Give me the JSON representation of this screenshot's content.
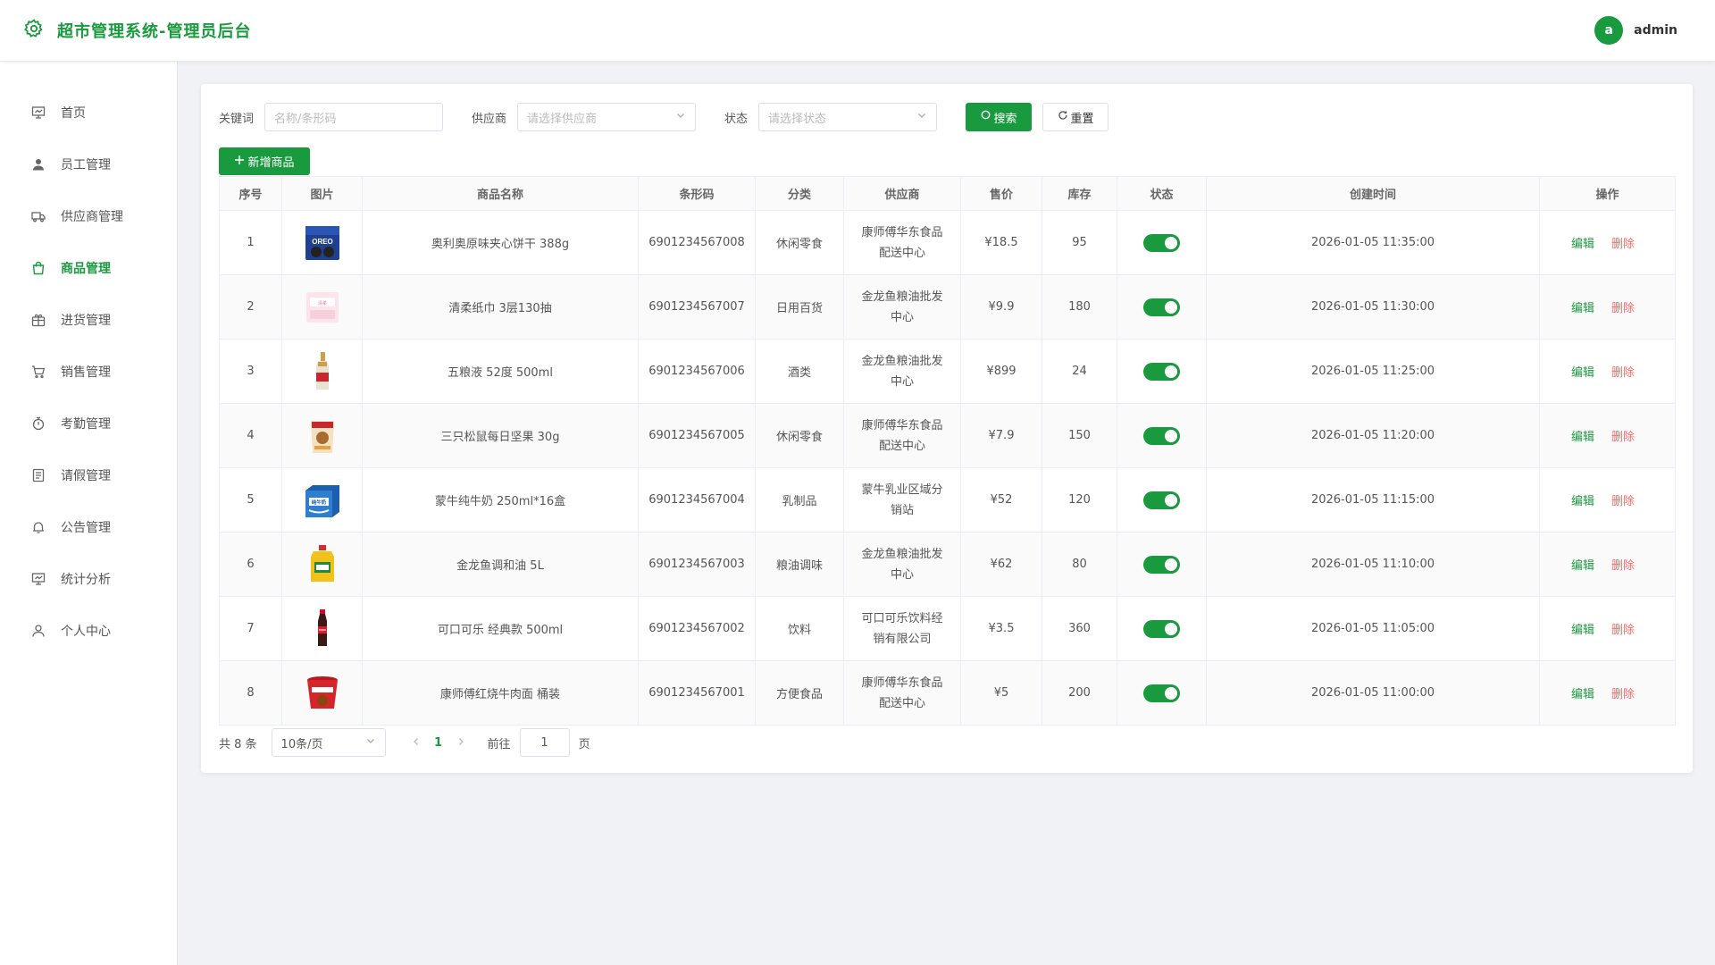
{
  "header": {
    "title": "超市管理系统-管理员后台",
    "avatar_letter": "a",
    "username": "admin"
  },
  "sidebar": {
    "items": [
      {
        "label": "首页",
        "icon": "dashboard-icon",
        "active": false
      },
      {
        "label": "员工管理",
        "icon": "user-icon",
        "active": false
      },
      {
        "label": "供应商管理",
        "icon": "truck-icon",
        "active": false
      },
      {
        "label": "商品管理",
        "icon": "shopping-bag-icon",
        "active": true
      },
      {
        "label": "进货管理",
        "icon": "package-icon",
        "active": false
      },
      {
        "label": "销售管理",
        "icon": "cart-icon",
        "active": false
      },
      {
        "label": "考勤管理",
        "icon": "stopwatch-icon",
        "active": false
      },
      {
        "label": "请假管理",
        "icon": "document-icon",
        "active": false
      },
      {
        "label": "公告管理",
        "icon": "bell-icon",
        "active": false
      },
      {
        "label": "统计分析",
        "icon": "chart-icon",
        "active": false
      },
      {
        "label": "个人中心",
        "icon": "person-icon",
        "active": false
      }
    ]
  },
  "filters": {
    "keyword_label": "关键词",
    "keyword_placeholder": "名称/条形码",
    "supplier_label": "供应商",
    "supplier_placeholder": "请选择供应商",
    "status_label": "状态",
    "status_placeholder": "请选择状态",
    "search_label": "搜索",
    "reset_label": "重置"
  },
  "add_button_label": "新增商品",
  "table": {
    "headers": [
      "序号",
      "图片",
      "商品名称",
      "条形码",
      "分类",
      "供应商",
      "售价",
      "库存",
      "状态",
      "创建时间",
      "操作"
    ],
    "edit_label": "编辑",
    "delete_label": "删除",
    "rows": [
      {
        "idx": "1",
        "name": "奥利奥原味夹心饼干 388g",
        "barcode": "6901234567008",
        "category": "休闲零食",
        "supplier": "康师傅华东食品配送中心",
        "price": "¥18.5",
        "stock": "95",
        "enabled": true,
        "created": "2026-01-05 11:35:00",
        "thumb": "oreo"
      },
      {
        "idx": "2",
        "name": "清柔纸巾 3层130抽",
        "barcode": "6901234567007",
        "category": "日用百货",
        "supplier": "金龙鱼粮油批发中心",
        "price": "¥9.9",
        "stock": "180",
        "enabled": true,
        "created": "2026-01-05 11:30:00",
        "thumb": "tissue"
      },
      {
        "idx": "3",
        "name": "五粮液 52度 500ml",
        "barcode": "6901234567006",
        "category": "酒类",
        "supplier": "金龙鱼粮油批发中心",
        "price": "¥899",
        "stock": "24",
        "enabled": true,
        "created": "2026-01-05 11:25:00",
        "thumb": "liquor"
      },
      {
        "idx": "4",
        "name": "三只松鼠每日坚果 30g",
        "barcode": "6901234567005",
        "category": "休闲零食",
        "supplier": "康师傅华东食品配送中心",
        "price": "¥7.9",
        "stock": "150",
        "enabled": true,
        "created": "2026-01-05 11:20:00",
        "thumb": "nuts"
      },
      {
        "idx": "5",
        "name": "蒙牛纯牛奶 250ml*16盒",
        "barcode": "6901234567004",
        "category": "乳制品",
        "supplier": "蒙牛乳业区域分销站",
        "price": "¥52",
        "stock": "120",
        "enabled": true,
        "created": "2026-01-05 11:15:00",
        "thumb": "milk"
      },
      {
        "idx": "6",
        "name": "金龙鱼调和油 5L",
        "barcode": "6901234567003",
        "category": "粮油调味",
        "supplier": "金龙鱼粮油批发中心",
        "price": "¥62",
        "stock": "80",
        "enabled": true,
        "created": "2026-01-05 11:10:00",
        "thumb": "oil"
      },
      {
        "idx": "7",
        "name": "可口可乐 经典款 500ml",
        "barcode": "6901234567002",
        "category": "饮料",
        "supplier": "可口可乐饮料经销有限公司",
        "price": "¥3.5",
        "stock": "360",
        "enabled": true,
        "created": "2026-01-05 11:05:00",
        "thumb": "cola"
      },
      {
        "idx": "8",
        "name": "康师傅红烧牛肉面 桶装",
        "barcode": "6901234567001",
        "category": "方便食品",
        "supplier": "康师傅华东食品配送中心",
        "price": "¥5",
        "stock": "200",
        "enabled": true,
        "created": "2026-01-05 11:00:00",
        "thumb": "noodle"
      }
    ]
  },
  "pagination": {
    "total_text": "共 8 条",
    "page_size": "10条/页",
    "current_page": "1",
    "goto_label": "前往",
    "goto_value": "1",
    "page_suffix": "页"
  },
  "colors": {
    "primary": "#1a9a3e",
    "danger": "#f56c6c"
  }
}
